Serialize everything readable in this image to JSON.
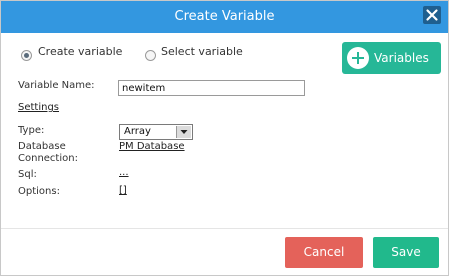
{
  "dialog": {
    "title": "Create Variable",
    "close_icon": "close-icon"
  },
  "mode": {
    "create_label": "Create variable",
    "select_label": "Select variable",
    "selected": "create"
  },
  "variables_button": {
    "label": "Variables",
    "icon": "plus-circle-icon"
  },
  "form": {
    "name_label": "Variable Name:",
    "name_value": "newitem",
    "settings_label": "Settings",
    "type_label": "Type:",
    "type_value": "Array",
    "db_label_line1": "Database",
    "db_label_line2": "Connection:",
    "db_value": "PM Database",
    "sql_label": "Sql:",
    "sql_value": "...",
    "options_label": "Options:",
    "options_value": "[]"
  },
  "footer": {
    "cancel_label": "Cancel",
    "save_label": "Save"
  },
  "colors": {
    "titlebar": "#3397e0",
    "variables_button": "#26b797",
    "cancel": "#e4625a",
    "save": "#21b98c"
  }
}
